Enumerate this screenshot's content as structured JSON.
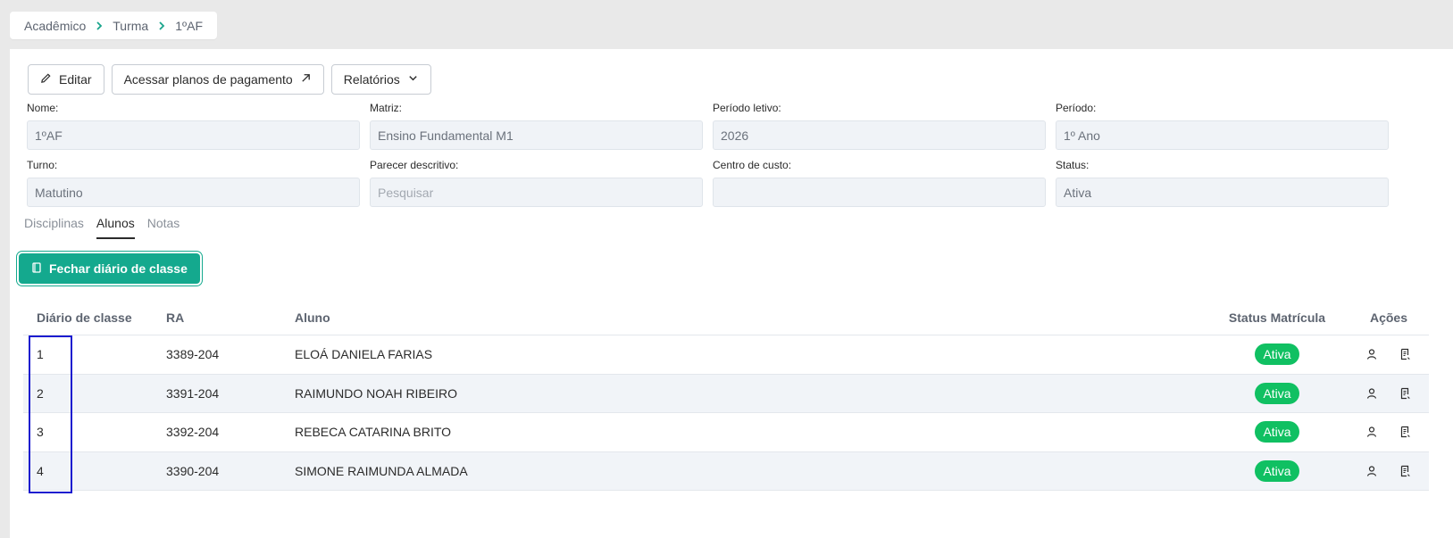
{
  "breadcrumb": [
    "Acadêmico",
    "Turma",
    "1ºAF"
  ],
  "toolbar": {
    "edit_label": "Editar",
    "payment_plans_label": "Acessar planos de pagamento",
    "reports_label": "Relatórios"
  },
  "fields": [
    {
      "label": "Nome:",
      "value": "1ºAF"
    },
    {
      "label": "Matriz:",
      "value": "Ensino Fundamental M1"
    },
    {
      "label": "Período letivo:",
      "value": "2026"
    },
    {
      "label": "Período:",
      "value": "1º Ano"
    },
    {
      "label": "Turno:",
      "value": "Matutino"
    },
    {
      "label": "Parecer descritivo:",
      "placeholder": "Pesquisar"
    },
    {
      "label": "Centro de custo:",
      "value": ""
    },
    {
      "label": "Status:",
      "value": "Ativa"
    }
  ],
  "tabs": [
    {
      "label": "Disciplinas",
      "active": false
    },
    {
      "label": "Alunos",
      "active": true
    },
    {
      "label": "Notas",
      "active": false
    }
  ],
  "close_diary_label": "Fechar diário de classe",
  "table": {
    "headers": [
      "Diário de classe",
      "RA",
      "Aluno",
      "Status Matrícula",
      "Ações"
    ],
    "rows": [
      {
        "diario": "1",
        "ra": "3389-204",
        "aluno": "ELOÁ DANIELA FARIAS",
        "status": "Ativa"
      },
      {
        "diario": "2",
        "ra": "3391-204",
        "aluno": "RAIMUNDO NOAH RIBEIRO",
        "status": "Ativa"
      },
      {
        "diario": "3",
        "ra": "3392-204",
        "aluno": "REBECA CATARINA BRITO",
        "status": "Ativa"
      },
      {
        "diario": "4",
        "ra": "3390-204",
        "aluno": "SIMONE RAIMUNDA ALMADA",
        "status": "Ativa"
      }
    ]
  },
  "colors": {
    "accent": "#14a98e",
    "status_active": "#10c062",
    "highlight": "#1c1ccf"
  },
  "icons": {
    "edit": "pencil-icon",
    "external": "arrow-up-right-icon",
    "dropdown": "chevron-down-icon",
    "book": "book-icon",
    "person": "person-icon",
    "document": "document-icon"
  }
}
